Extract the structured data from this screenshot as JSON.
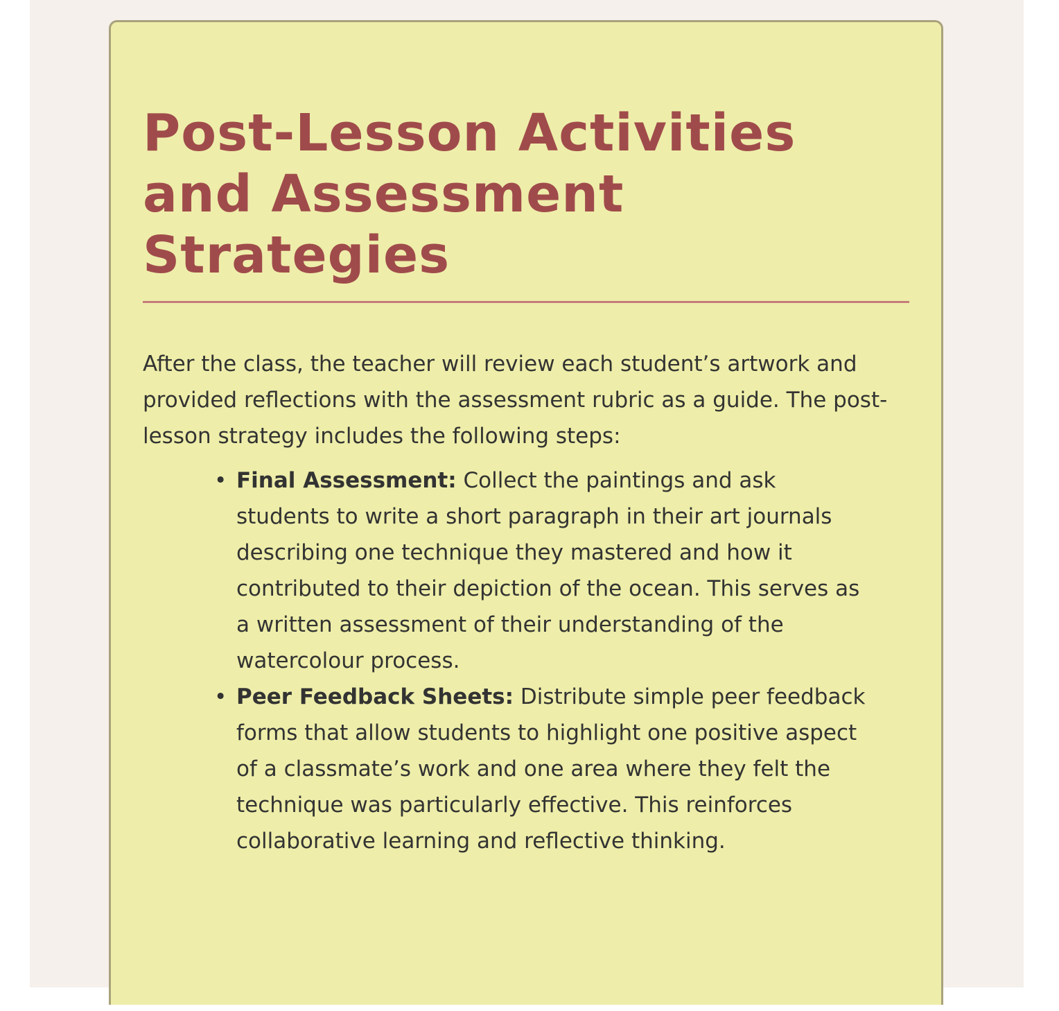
{
  "document": {
    "title": "Post-Lesson Activities and Assessment Strategies",
    "intro": "After the class, the teacher will review each student’s artwork and provided reflections with the assessment rubric as a guide. The post-lesson strategy includes the following steps:",
    "items": [
      {
        "label": "Final Assessment:",
        "text": " Collect the paintings and ask students to write a short paragraph in their art journals describing one technique they mastered and how it contributed to their depiction of the ocean. This serves as a written assessment of their understanding of the watercolour process."
      },
      {
        "label": "Peer Feedback Sheets:",
        "text": " Distribute simple peer feedback forms that allow students to highlight one positive aspect of a classmate’s work and one area where they felt the technique was particularly effective. This reinforces collaborative learning and reflective thinking."
      }
    ]
  },
  "colors": {
    "page_background": "#f5f0eb",
    "card_background": "#eeeeaa",
    "card_border": "#a9a27c",
    "title": "#a04b4b",
    "rule": "#c67b7b",
    "body_text": "#333333"
  }
}
